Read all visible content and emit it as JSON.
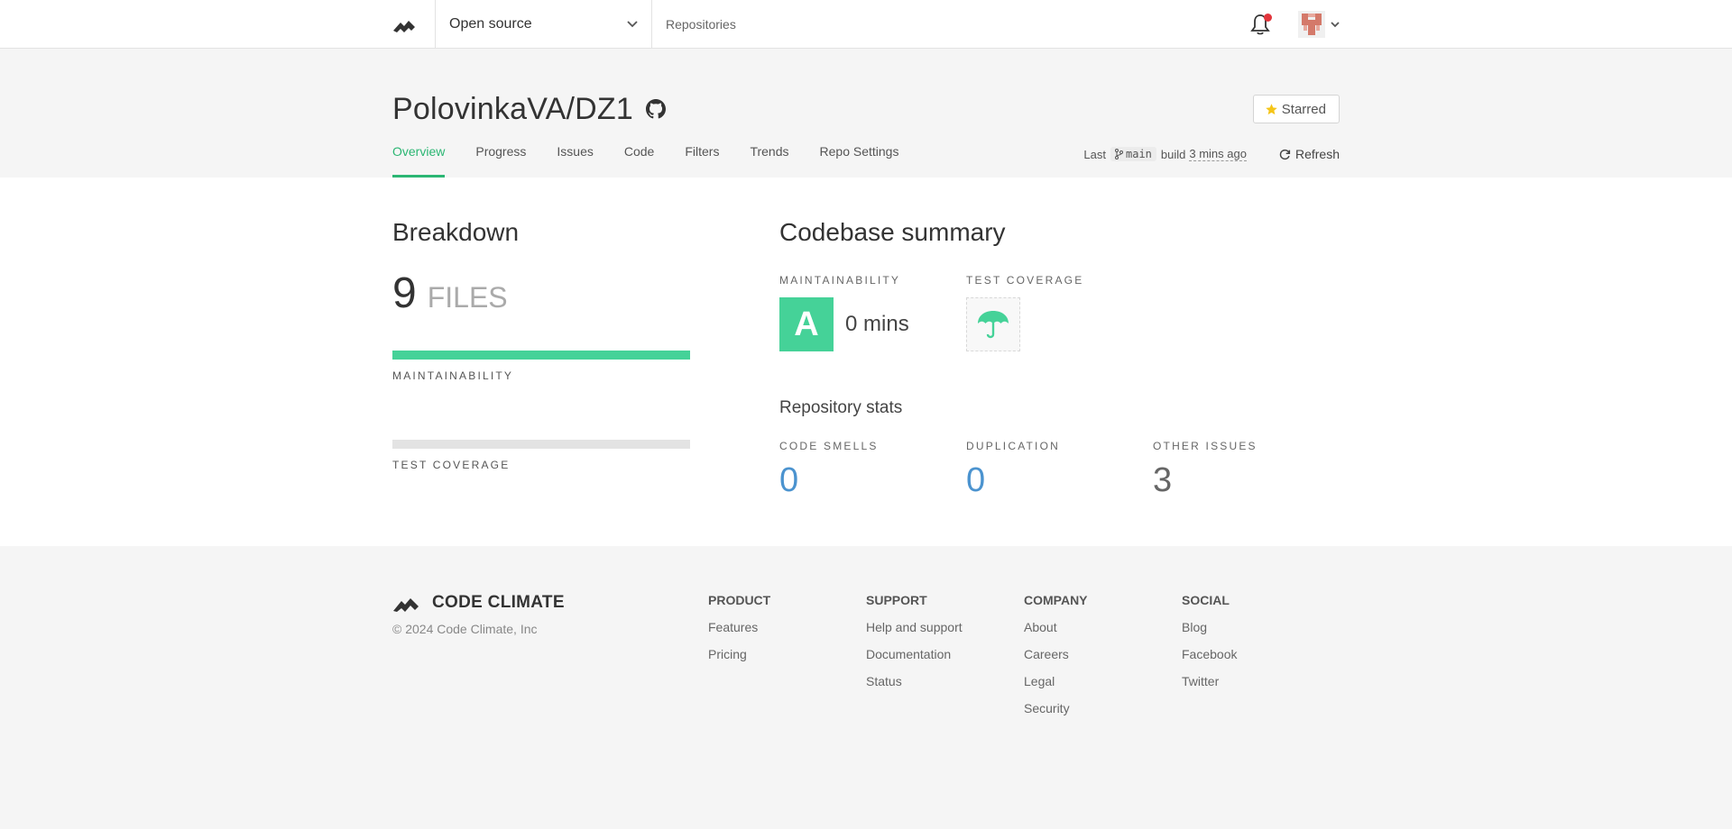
{
  "nav": {
    "org": "Open source",
    "repositories": "Repositories"
  },
  "repo": {
    "title": "PolovinkaVA/DZ1",
    "starred": "Starred",
    "tabs": [
      "Overview",
      "Progress",
      "Issues",
      "Code",
      "Filters",
      "Trends",
      "Repo Settings"
    ],
    "active_tab": "Overview",
    "build": {
      "prefix": "Last",
      "branch": "main",
      "mid": "build",
      "time": "3 mins ago",
      "refresh": "Refresh"
    }
  },
  "breakdown": {
    "title": "Breakdown",
    "count": "9",
    "unit": "FILES",
    "maintainability_label": "MAINTAINABILITY",
    "maintainability_fill": 1.0,
    "coverage_label": "TEST COVERAGE",
    "coverage_fill": 0
  },
  "summary": {
    "title": "Codebase summary",
    "maintainability_label": "MAINTAINABILITY",
    "grade": "A",
    "debt": "0 mins",
    "coverage_label": "TEST COVERAGE",
    "coverage_icon": "umbrella-icon"
  },
  "stats": {
    "title": "Repository stats",
    "items": [
      {
        "label": "CODE SMELLS",
        "value": "0"
      },
      {
        "label": "DUPLICATION",
        "value": "0"
      },
      {
        "label": "OTHER ISSUES",
        "value": "3"
      }
    ]
  },
  "footer": {
    "brand": "CODE CLIMATE",
    "copyright": "© 2024 Code Climate, Inc",
    "columns": [
      {
        "title": "PRODUCT",
        "links": [
          "Features",
          "Pricing"
        ]
      },
      {
        "title": "SUPPORT",
        "links": [
          "Help and support",
          "Documentation",
          "Status"
        ]
      },
      {
        "title": "COMPANY",
        "links": [
          "About",
          "Careers",
          "Legal",
          "Security"
        ]
      },
      {
        "title": "SOCIAL",
        "links": [
          "Blog",
          "Facebook",
          "Twitter"
        ]
      }
    ]
  },
  "colors": {
    "accent": "#2bb673",
    "grade_a": "#45d298",
    "link_value": "#4b93cf",
    "notification": "#e2353c"
  }
}
